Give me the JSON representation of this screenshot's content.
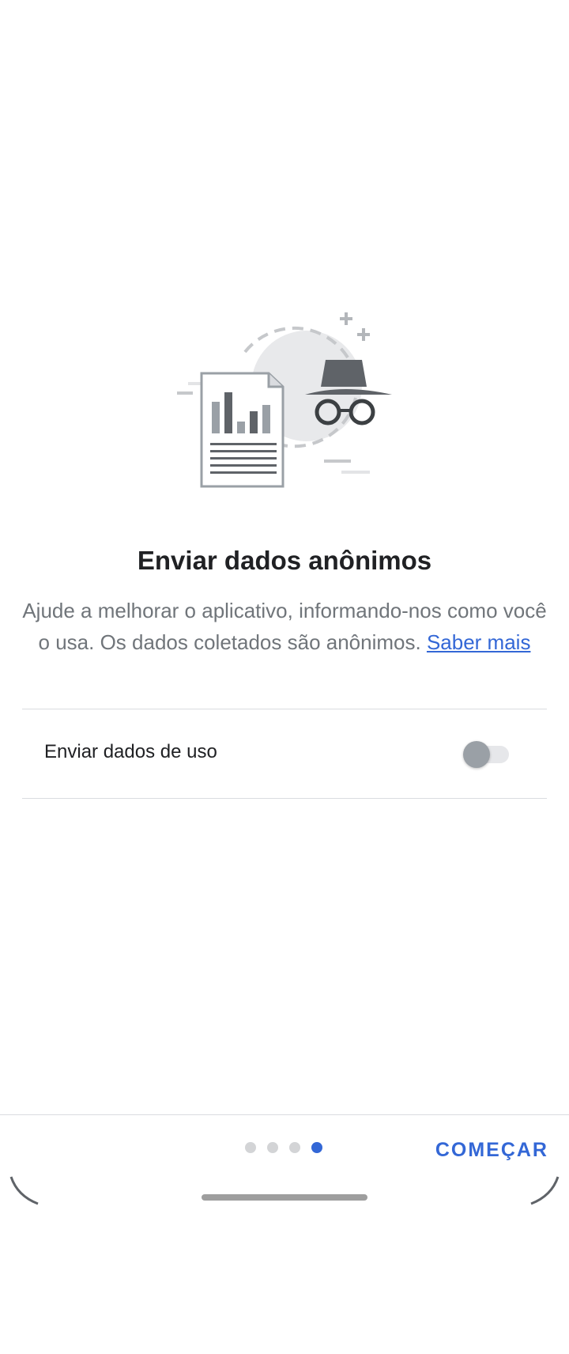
{
  "onboarding": {
    "title": "Enviar dados anônimos",
    "description": "Ajude a melhorar o aplicativo, informando-nos como você o usa. Os dados coletados são anônimos. ",
    "learn_more": "Saber mais",
    "illustration_icon": "anonymous-data-illustration"
  },
  "setting": {
    "label": "Enviar dados de uso",
    "enabled": false
  },
  "footer": {
    "page_count": 4,
    "current_page": 4,
    "start_label": "COMEÇAR"
  },
  "colors": {
    "accent": "#3367d6",
    "title": "#202124",
    "body": "#70757a",
    "divider": "#dadce0",
    "toggle_thumb_off": "#9aa0a6",
    "toggle_track_off": "#e6e7ea"
  }
}
